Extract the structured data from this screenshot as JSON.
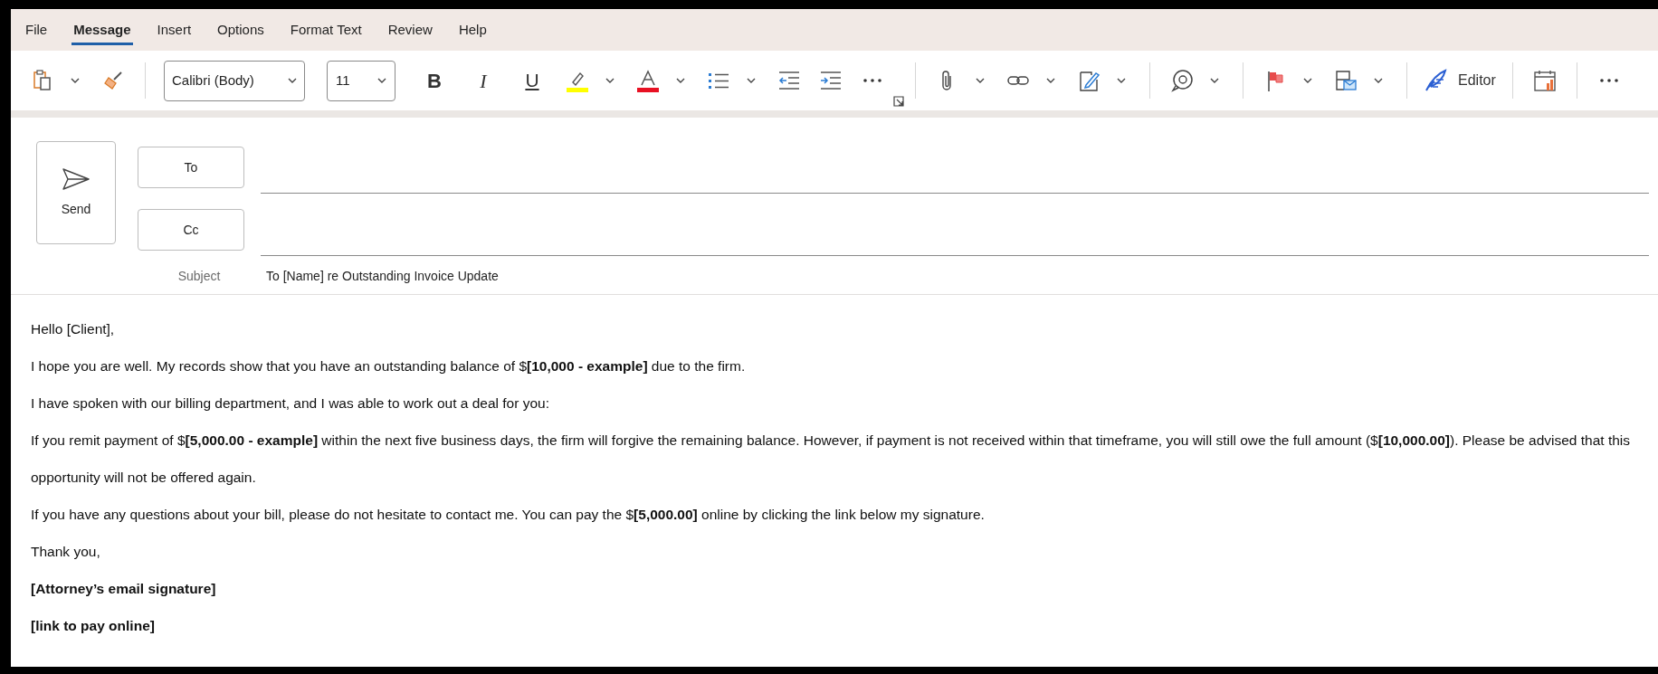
{
  "menu_tabs": [
    {
      "label": "File",
      "selected": false
    },
    {
      "label": "Message",
      "selected": true
    },
    {
      "label": "Insert",
      "selected": false
    },
    {
      "label": "Options",
      "selected": false
    },
    {
      "label": "Format Text",
      "selected": false
    },
    {
      "label": "Review",
      "selected": false
    },
    {
      "label": "Help",
      "selected": false
    }
  ],
  "toolbar": {
    "font": "Calibri (Body)",
    "size": "11",
    "bold": "B",
    "italic": "I",
    "underline": "U",
    "editor": "Editor"
  },
  "compose": {
    "send": "Send",
    "to": "To",
    "cc": "Cc",
    "subject_label": "Subject",
    "subject": "To [Name] re Outstanding Invoice Update"
  },
  "body": [
    {
      "kind": "text",
      "text": "Hello [Client],"
    },
    {
      "kind": "text",
      "text": "I hope you are well. My records show that you have an outstanding balance of $**[10,000 - example]** due to the firm."
    },
    {
      "kind": "text",
      "text": "I have spoken with our billing department, and I was able to work out a deal for you:"
    },
    {
      "kind": "text",
      "text": "If you remit payment of $**[5,000.00 - example]** within the next five business days, the firm will forgive the remaining balance. However, if payment is not received within that timeframe, you will still owe the full amount ($**[10,000.00]**). Please be advised that this opportunity will not be offered again."
    },
    {
      "kind": "text",
      "text": "If you have any questions about your bill, please do not hesitate to contact me. You can pay the $**[5,000.00]** online by clicking the link below my signature."
    },
    {
      "kind": "text",
      "text": "Thank you,"
    },
    {
      "kind": "signature",
      "text": "[Attorney’s email signature]"
    },
    {
      "kind": "signature",
      "text": "[link to pay online]"
    }
  ]
}
